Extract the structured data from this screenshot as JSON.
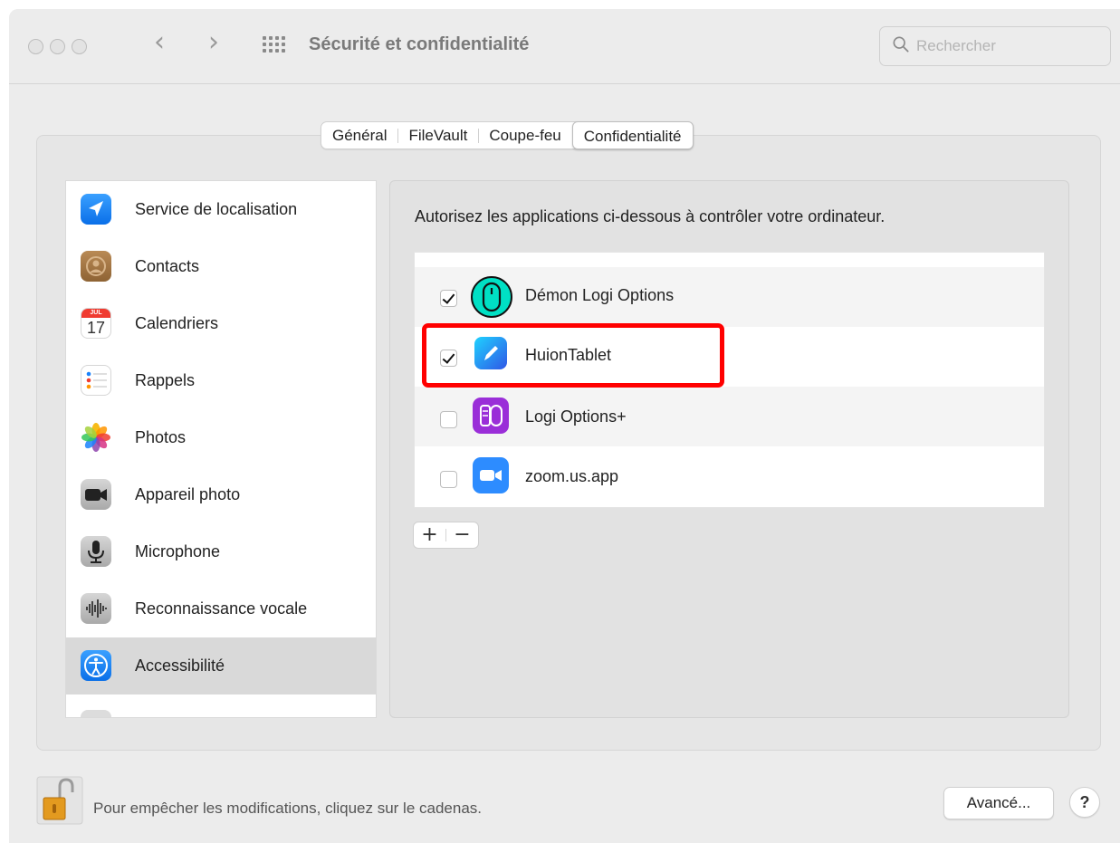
{
  "window": {
    "title": "Sécurité et confidentialité",
    "search_placeholder": "Rechercher"
  },
  "tabs": [
    {
      "label": "Général",
      "active": false
    },
    {
      "label": "FileVault",
      "active": false
    },
    {
      "label": "Coupe-feu",
      "active": false
    },
    {
      "label": "Confidentialité",
      "active": true
    }
  ],
  "sidebar": {
    "items": [
      {
        "label": "Service de localisation",
        "icon": "location-arrow-icon"
      },
      {
        "label": "Contacts",
        "icon": "contacts-icon"
      },
      {
        "label": "Calendriers",
        "icon": "calendar-icon",
        "calendar_month": "JUL",
        "calendar_day": "17"
      },
      {
        "label": "Rappels",
        "icon": "reminders-icon"
      },
      {
        "label": "Photos",
        "icon": "photos-icon"
      },
      {
        "label": "Appareil photo",
        "icon": "camera-icon"
      },
      {
        "label": "Microphone",
        "icon": "microphone-icon"
      },
      {
        "label": "Reconnaissance vocale",
        "icon": "speech-recognition-icon"
      },
      {
        "label": "Accessibilité",
        "icon": "accessibility-icon",
        "selected": true
      }
    ]
  },
  "main": {
    "description": "Autorisez les applications ci-dessous à contrôler votre ordinateur.",
    "apps": [
      {
        "name": "Démon Logi Options",
        "checked": true,
        "icon": "logi-mouse-icon"
      },
      {
        "name": "HuionTablet",
        "checked": true,
        "icon": "huion-pen-icon",
        "highlighted": true
      },
      {
        "name": "Logi Options+",
        "checked": false,
        "icon": "logi-options-plus-icon"
      },
      {
        "name": "zoom.us.app",
        "checked": false,
        "icon": "zoom-camera-icon"
      }
    ],
    "add_label": "+",
    "remove_label": "−"
  },
  "footer": {
    "lock_text": "Pour empêcher les modifications, cliquez sur le cadenas.",
    "advanced_label": "Avancé...",
    "help_label": "?"
  },
  "colors": {
    "highlight": "#ff0000",
    "accent": "#1a82fb"
  }
}
